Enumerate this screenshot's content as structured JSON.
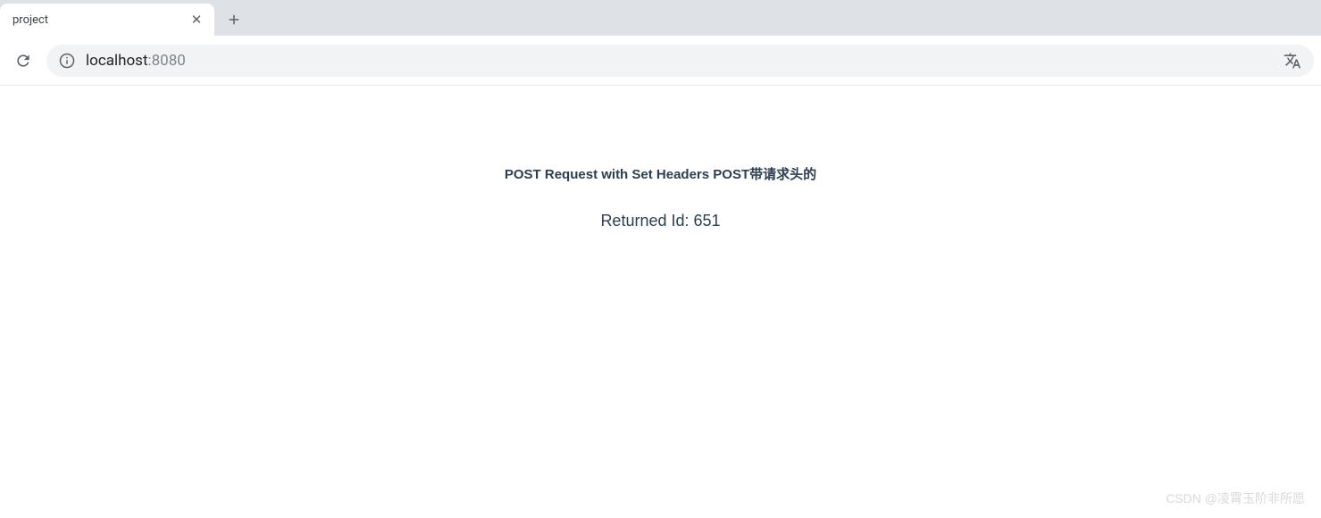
{
  "tab": {
    "title": "project"
  },
  "address": {
    "host": "localhost",
    "port": ":8080"
  },
  "page": {
    "heading": "POST Request with Set Headers POST带请求头的",
    "result": "Returned Id: 651"
  },
  "watermark": "CSDN @凌霄玉阶非所愿"
}
